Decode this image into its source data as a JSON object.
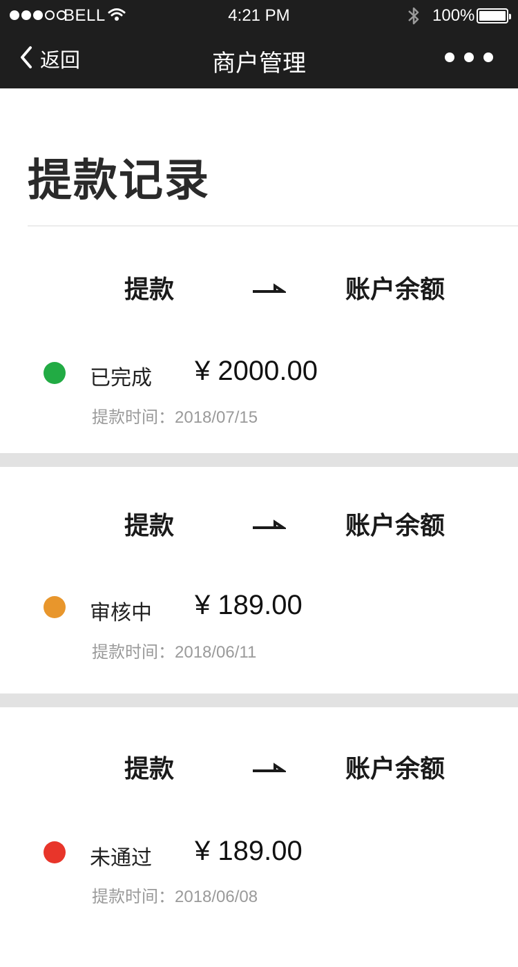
{
  "status_bar": {
    "carrier": "BELL",
    "time": "4:21 PM",
    "battery": "100%"
  },
  "nav": {
    "back_label": "返回",
    "title": "商户管理",
    "more_icon": "ellipsis-icon"
  },
  "page": {
    "title": "提款记录"
  },
  "records": [
    {
      "from": "提款",
      "to": "账户余额",
      "status": "已完成",
      "status_color": "#22ab44",
      "amount": "¥ 2000.00",
      "time_line": "提款时间：2018/07/15"
    },
    {
      "from": "提款",
      "to": "账户余额",
      "status": "审核中",
      "status_color": "#e8962c",
      "amount": "¥ 189.00",
      "time_line": "提款时间：2018/06/11"
    },
    {
      "from": "提款",
      "to": "账户余额",
      "status": "未通过",
      "status_color": "#e8352a",
      "amount": "¥ 189.00",
      "time_line": "提款时间：2018/06/08"
    }
  ]
}
